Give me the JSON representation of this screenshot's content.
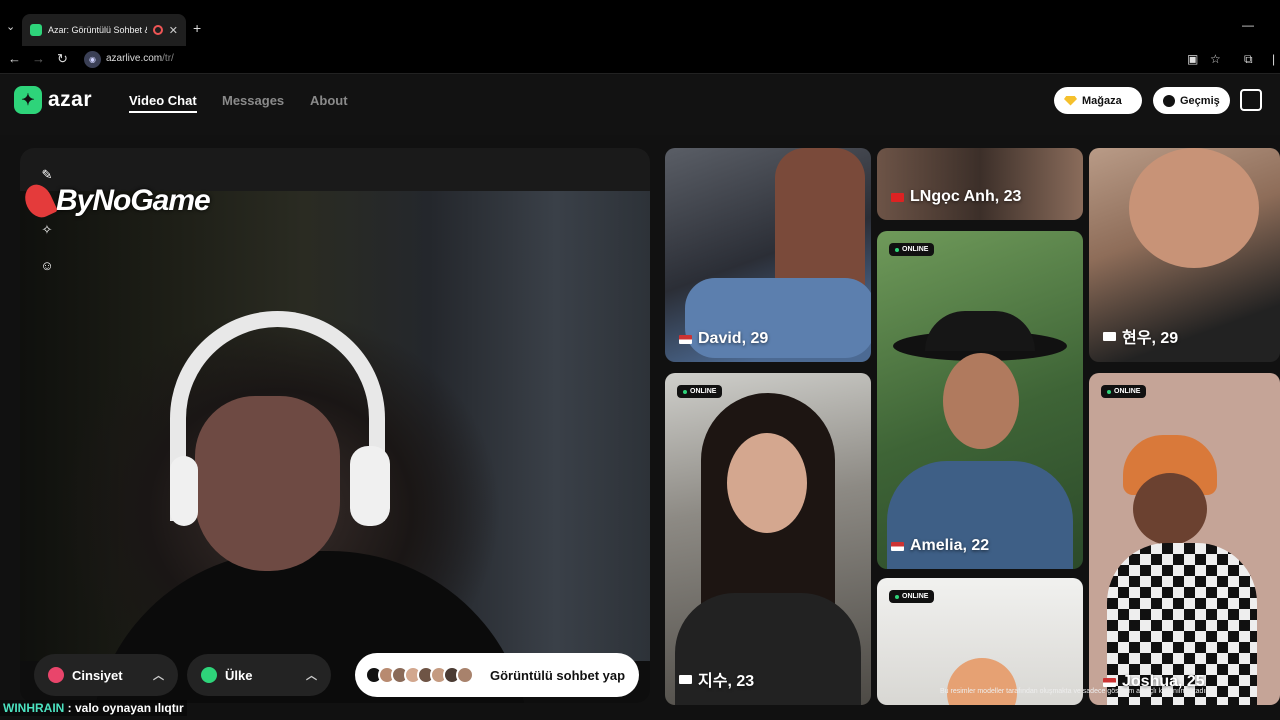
{
  "browser": {
    "tab_title": "Azar: Görüntülü Sohbet & V",
    "new_tab_icon": "plus-icon",
    "url_domain": "azarlive.com",
    "url_path": "/tr/"
  },
  "app": {
    "logo_text": "azar",
    "nav": [
      {
        "label": "Video Chat",
        "active": true
      },
      {
        "label": "Messages",
        "active": false
      },
      {
        "label": "About",
        "active": false
      }
    ],
    "shop_label": "Mağaza",
    "history_label": "Geçmiş",
    "accent": "#2ed47a"
  },
  "video": {
    "watermark": "ByNoGame",
    "tools": [
      "pen-icon",
      "magic-wand-icon",
      "smile-icon"
    ],
    "gender_label": "Cinsiyet",
    "country_label": "Ülke",
    "start_label": "Görüntülü sohbet yap"
  },
  "profiles": [
    {
      "name": "David, 29",
      "flag": "us",
      "online": false
    },
    {
      "name": "LNgọc Anh, 23",
      "flag": "vn",
      "online": false
    },
    {
      "name": "현우, 29",
      "flag": "kr",
      "online": false
    },
    {
      "name": "Amelia, 22",
      "flag": "us",
      "online": true
    },
    {
      "name": "지수, 23",
      "flag": "kr",
      "online": true
    },
    {
      "name": "Joshua, 25",
      "flag": "us",
      "online": true
    },
    {
      "name": "",
      "flag": "",
      "online": true
    }
  ],
  "online_label": "ONLINE",
  "footer_note": "Bu resimler modeller tarafından oluşmakta ve sadece gösterim amaçlı kullanılmaktadır.",
  "chat": {
    "user": "WINHRAIN",
    "message": " : valo oynayan ılıqtır"
  }
}
